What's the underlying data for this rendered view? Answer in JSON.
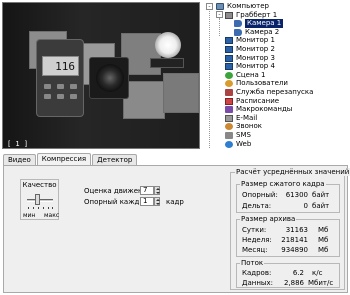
{
  "video": {
    "camera_label": "[ 1 ]",
    "meter_reading": "116"
  },
  "tree": {
    "items": [
      {
        "label": "Компьютер",
        "icon": "computer-icon"
      },
      {
        "label": "Грабберт 1",
        "icon": "grabber-icon"
      },
      {
        "label": "Камера 1",
        "icon": "camera-icon",
        "selected": true
      },
      {
        "label": "Камера 2",
        "icon": "camera-icon"
      },
      {
        "label": "Монитор 1",
        "icon": "monitor-icon"
      },
      {
        "label": "Монитор 2",
        "icon": "monitor-icon"
      },
      {
        "label": "Монитор 3",
        "icon": "monitor-icon"
      },
      {
        "label": "Монитор 4",
        "icon": "monitor-icon"
      },
      {
        "label": "Сцена 1",
        "icon": "scene-icon"
      },
      {
        "label": "Пользователи",
        "icon": "users-icon"
      },
      {
        "label": "Служба перезапуска",
        "icon": "restart-service-icon"
      },
      {
        "label": "Расписание",
        "icon": "schedule-icon"
      },
      {
        "label": "Макрокоманды",
        "icon": "macro-icon"
      },
      {
        "label": "E-Mail",
        "icon": "email-icon"
      },
      {
        "label": "Звонок",
        "icon": "phone-call-icon"
      },
      {
        "label": "SMS",
        "icon": "sms-icon"
      },
      {
        "label": "Web",
        "icon": "web-globe-icon"
      }
    ]
  },
  "tabs": [
    "Видео",
    "Компрессия",
    "Детектор"
  ],
  "active_tab": "Компрессия",
  "compression": {
    "quality_title": "Качество",
    "quality_min": "мин",
    "quality_max": "макс",
    "motion_label": "Оценка движения",
    "motion_value": "7",
    "keyframe_label": "Опорный каждый",
    "keyframe_value": "1",
    "keyframe_unit": "кадр"
  },
  "stats": {
    "title": "Расчёт усреднённых значений",
    "frame_size": {
      "title": "Размер сжатого кадра",
      "rows": [
        {
          "label": "Опорный:",
          "value": "61300",
          "unit": "байт"
        },
        {
          "label": "Дельта:",
          "value": "0",
          "unit": "байт"
        }
      ]
    },
    "archive_size": {
      "title": "Размер архива",
      "rows": [
        {
          "label": "Сутки:",
          "value": "31163",
          "unit": "Мб"
        },
        {
          "label": "Неделя:",
          "value": "218141",
          "unit": "Мб"
        },
        {
          "label": "Месяц:",
          "value": "934890",
          "unit": "Мб"
        }
      ]
    },
    "stream": {
      "title": "Поток",
      "rows": [
        {
          "label": "Кадров:",
          "value": "6.2",
          "unit": "к/с"
        },
        {
          "label": "Данных:",
          "value": "2,886",
          "unit": "Мбит/с"
        }
      ]
    }
  },
  "colors": {
    "selection": "#0a246a",
    "panel_bg": "#efefef",
    "video_bg": "#1b1b1b"
  }
}
